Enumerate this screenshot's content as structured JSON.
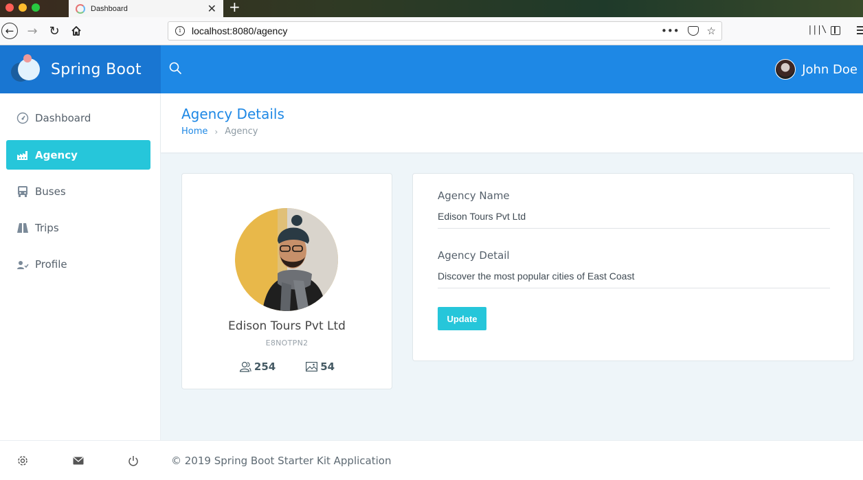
{
  "browser": {
    "tab_title": "Dashboard",
    "tab_close": "✕",
    "new_tab": "+",
    "url_host": "localhost",
    "url_rest": ":8080/agency",
    "url_more": "•••"
  },
  "header": {
    "brand_name": "Spring Boot",
    "user_name": "John Doe"
  },
  "sidebar": {
    "items": [
      {
        "label": "Dashboard",
        "icon": "dashboard-icon",
        "active": false
      },
      {
        "label": "Agency",
        "icon": "factory-icon",
        "active": true
      },
      {
        "label": "Buses",
        "icon": "bus-icon",
        "active": false
      },
      {
        "label": "Trips",
        "icon": "road-icon",
        "active": false
      },
      {
        "label": "Profile",
        "icon": "user-check-icon",
        "active": false
      }
    ],
    "footer_icons": [
      "gear-icon",
      "mail-icon",
      "power-icon"
    ]
  },
  "page": {
    "title": "Agency Details",
    "breadcrumb": {
      "home": "Home",
      "separator": "›",
      "current": "Agency"
    }
  },
  "profile": {
    "name": "Edison Tours Pvt Ltd",
    "code": "E8NOTPN2",
    "stats": {
      "users": "254",
      "images": "54"
    }
  },
  "form": {
    "agency_name_label": "Agency Name",
    "agency_name_value": "Edison Tours Pvt Ltd",
    "agency_detail_label": "Agency Detail",
    "agency_detail_value": "Discover the most popular cities of East Coast",
    "update_label": "Update"
  },
  "footer": {
    "text": "© 2019 Spring Boot Starter Kit Application"
  },
  "colors": {
    "primary": "#1e88e5",
    "brand_bg": "#1976d2",
    "accent": "#26c6da",
    "content_bg": "#eef5f9"
  }
}
